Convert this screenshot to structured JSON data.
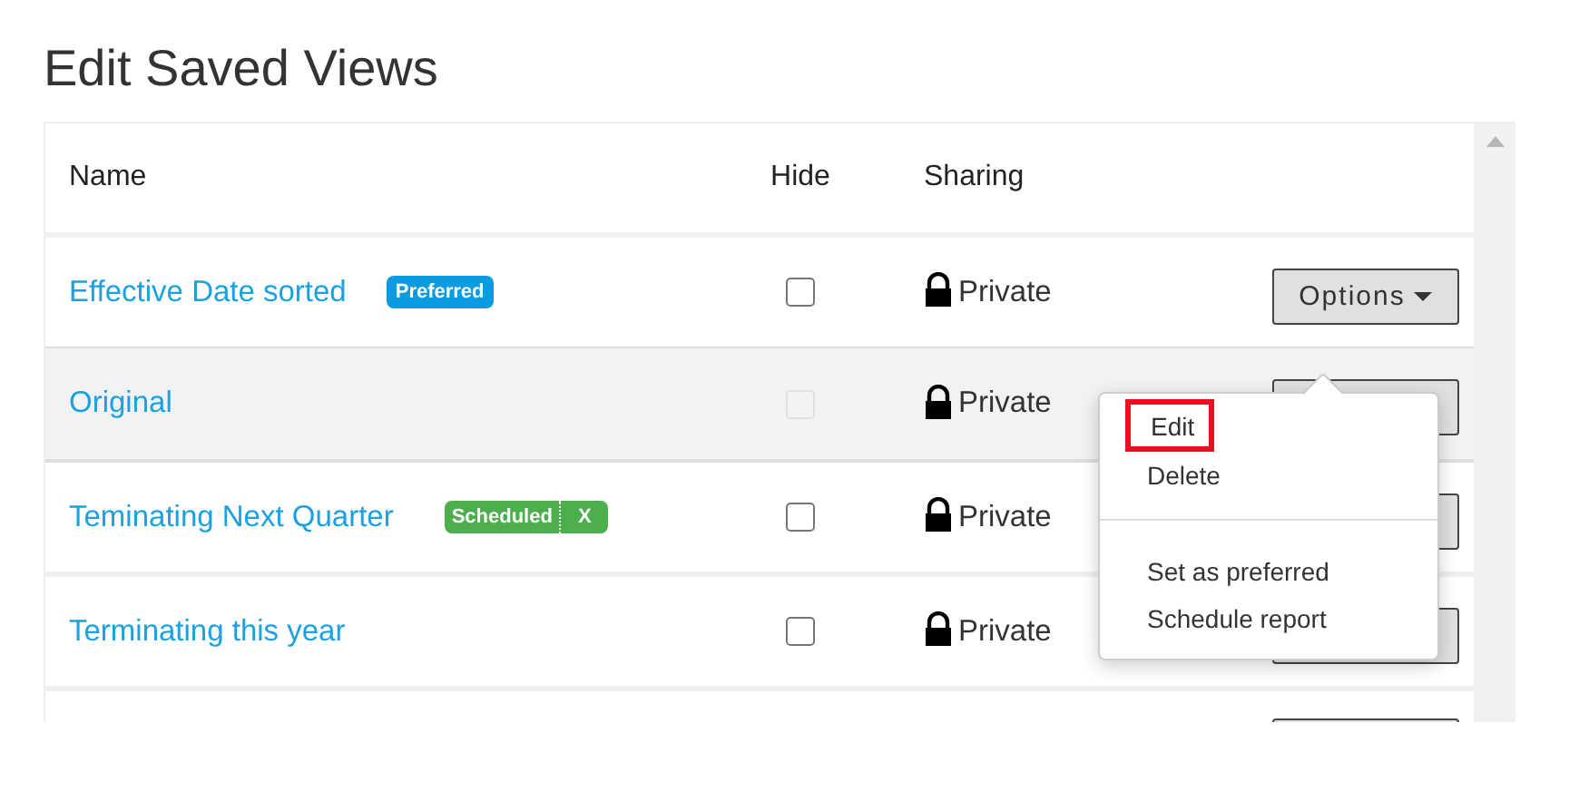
{
  "title": "Edit Saved Views",
  "columns": [
    "Name",
    "Hide",
    "Sharing"
  ],
  "rows": [
    {
      "kind": "view",
      "name": "Effective Date sorted",
      "badge": {
        "kind": "preferred",
        "label": "Preferred"
      },
      "checked": false,
      "disabled": false,
      "highlighted": false,
      "sharing": "Private",
      "options_label": "Options"
    },
    {
      "kind": "view",
      "name": "Original",
      "checked": false,
      "disabled": true,
      "highlighted": true,
      "sharing": "Private"
    },
    {
      "kind": "view",
      "name": "Teminating Next Quarter",
      "badge": {
        "kind": "scheduled",
        "label": "Scheduled",
        "remove": "X"
      },
      "checked": false,
      "disabled": false,
      "highlighted": false,
      "sharing": "Private"
    },
    {
      "kind": "view",
      "name": "Terminating this year",
      "checked": false,
      "disabled": false,
      "highlighted": false,
      "sharing": "Private"
    },
    {
      "kind": "partial"
    }
  ],
  "menu": {
    "sections": [
      [
        {
          "label": "Edit",
          "highlighted": true
        },
        {
          "label": "Delete",
          "highlighted": false
        }
      ],
      [
        {
          "label": "Set as preferred",
          "highlighted": false
        },
        {
          "label": "Schedule report",
          "highlighted": false
        }
      ]
    ]
  }
}
